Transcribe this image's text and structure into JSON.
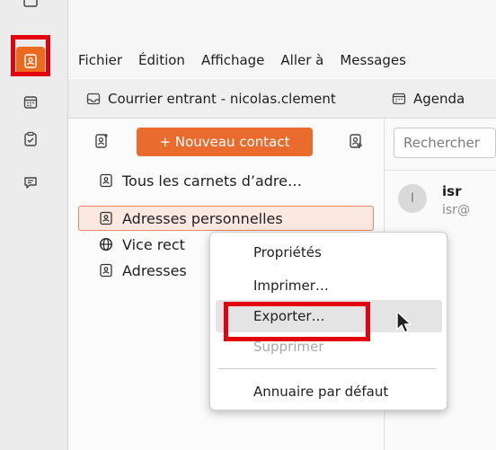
{
  "menubar": {
    "items": [
      "Fichier",
      "Édition",
      "Affichage",
      "Aller à",
      "Messages"
    ]
  },
  "tabs": [
    {
      "label": "Courrier entrant - nicolas.clement",
      "icon": "inbox-icon"
    },
    {
      "label": "Agenda",
      "icon": "calendar-icon"
    }
  ],
  "toolbar": {
    "new_contact_label": "+ Nouveau contact"
  },
  "addressbooks": [
    {
      "label": "Tous les carnets d’adre…",
      "icon": "address-book-icon"
    },
    {
      "label": "Adresses personnelles",
      "icon": "address-book-icon",
      "selected": true
    },
    {
      "label": "Vice rect",
      "icon": "globe-icon"
    },
    {
      "label": "Adresses",
      "icon": "address-book-icon"
    }
  ],
  "search": {
    "placeholder": "Rechercher"
  },
  "contact": {
    "avatar_letter": "I",
    "name": "isr",
    "email": "isr@"
  },
  "context_menu": {
    "items": [
      "Propriétés",
      "Imprimer…",
      "Exporter…",
      "Supprimer",
      "Annuaire par défaut"
    ],
    "disabled": [
      "Supprimer"
    ],
    "hovered": "Exporter…"
  },
  "colors": {
    "accent": "#e96b2d",
    "highlight_box": "#e3000f",
    "selection_bg": "#fbe9e1"
  }
}
